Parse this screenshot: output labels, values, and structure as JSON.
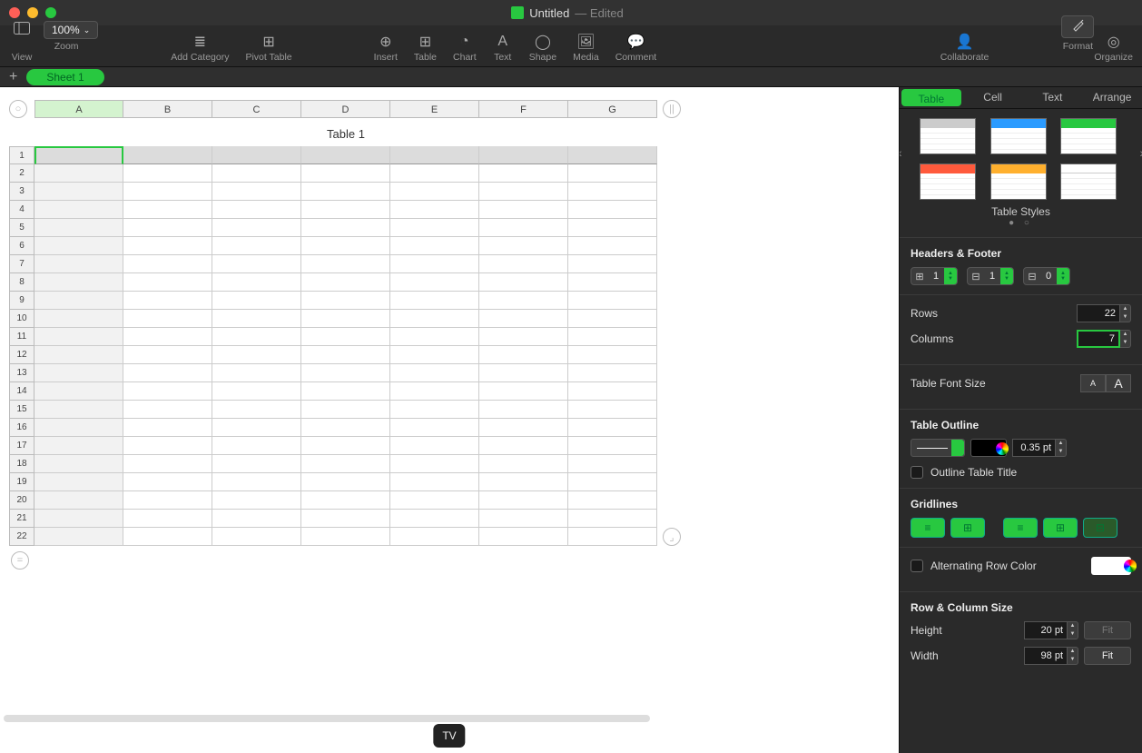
{
  "title": {
    "doc_name": "Untitled",
    "edited": "— Edited"
  },
  "toolbar": {
    "view": "View",
    "zoom_value": "100%",
    "zoom": "Zoom",
    "add_category": "Add Category",
    "pivot_table": "Pivot Table",
    "insert": "Insert",
    "table": "Table",
    "chart": "Chart",
    "text": "Text",
    "shape": "Shape",
    "media": "Media",
    "comment": "Comment",
    "collaborate": "Collaborate",
    "format": "Format",
    "organize": "Organize"
  },
  "sheet_tab": "Sheet 1",
  "table": {
    "title": "Table 1",
    "columns": [
      "A",
      "B",
      "C",
      "D",
      "E",
      "F",
      "G"
    ],
    "rows": 22
  },
  "panel": {
    "tabs": {
      "table": "Table",
      "cell": "Cell",
      "text": "Text",
      "arrange": "Arrange"
    },
    "styles_caption": "Table Styles",
    "headers_footer": "Headers & Footer",
    "header_rows": "1",
    "header_cols": "1",
    "footer_rows": "0",
    "rows_label": "Rows",
    "rows_value": "22",
    "cols_label": "Columns",
    "cols_value": "7",
    "font_size_label": "Table Font Size",
    "outline_label": "Table Outline",
    "outline_width": "0.35 pt",
    "outline_title": "Outline Table Title",
    "gridlines": "Gridlines",
    "alt_row": "Alternating Row Color",
    "row_col_size": "Row & Column Size",
    "height_label": "Height",
    "height_value": "20 pt",
    "width_label": "Width",
    "width_value": "98 pt",
    "fit": "Fit"
  },
  "status": {
    "tv": "TV",
    "handle_cols": "||",
    "handle_rows": "=",
    "handle_corner": "⌟"
  }
}
